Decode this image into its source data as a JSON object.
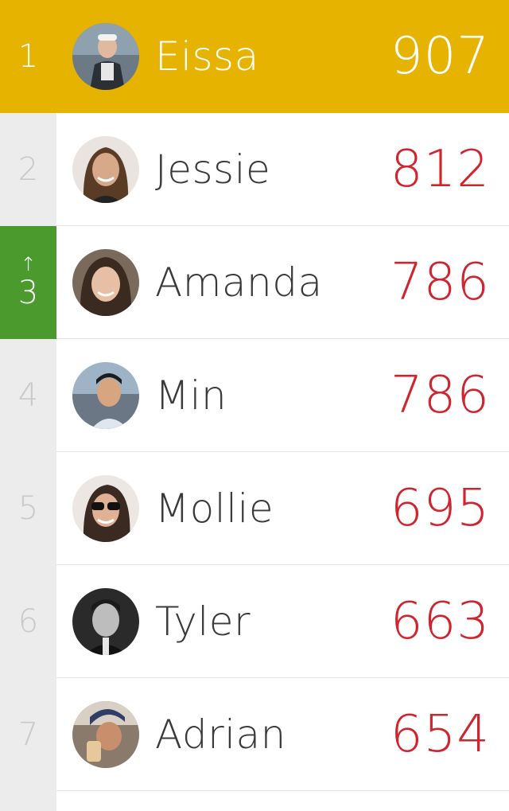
{
  "leaderboard": [
    {
      "rank": "1",
      "name": "Eissa",
      "score": "907",
      "arrow": ""
    },
    {
      "rank": "2",
      "name": "Jessie",
      "score": "812",
      "arrow": ""
    },
    {
      "rank": "3",
      "name": "Amanda",
      "score": "786",
      "arrow": "↑"
    },
    {
      "rank": "4",
      "name": "Min",
      "score": "786",
      "arrow": ""
    },
    {
      "rank": "5",
      "name": "Mollie",
      "score": "695",
      "arrow": ""
    },
    {
      "rank": "6",
      "name": "Tyler",
      "score": "663",
      "arrow": ""
    },
    {
      "rank": "7",
      "name": "Adrian",
      "score": "654",
      "arrow": ""
    }
  ],
  "colors": {
    "leader_bg": "#e6b400",
    "rank_up_bg": "#4a9a2e",
    "rank_bg": "#ececec",
    "score_color": "#d0242e",
    "name_color": "#3a3a3a"
  }
}
